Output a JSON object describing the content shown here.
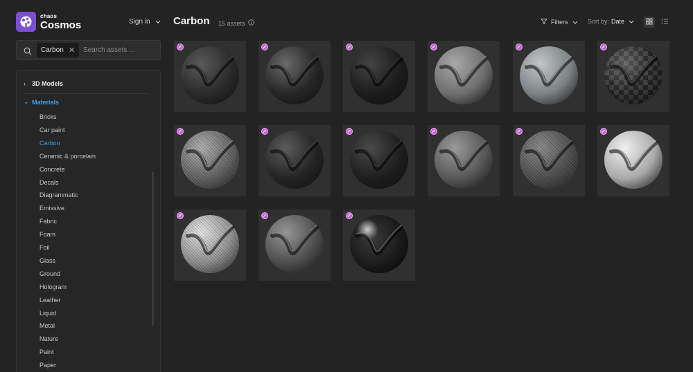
{
  "app": {
    "brand_top": "chaos",
    "brand_main": "Cosmos",
    "signin_label": "Sign in",
    "accent": "#3aa0e8",
    "brand_color": "#7a4fd0"
  },
  "search": {
    "chip_label": "Carbon",
    "placeholder": "Search assets ..."
  },
  "tree": {
    "models_label": "3D Models",
    "materials_label": "Materials",
    "items": [
      {
        "label": "Bricks"
      },
      {
        "label": "Car paint"
      },
      {
        "label": "Carbon",
        "active": true
      },
      {
        "label": "Ceramic & porcelain"
      },
      {
        "label": "Concrete"
      },
      {
        "label": "Decals"
      },
      {
        "label": "Diagrammatic"
      },
      {
        "label": "Emissive"
      },
      {
        "label": "Fabric"
      },
      {
        "label": "Foam"
      },
      {
        "label": "Foil"
      },
      {
        "label": "Glass"
      },
      {
        "label": "Ground"
      },
      {
        "label": "Hologram"
      },
      {
        "label": "Leather"
      },
      {
        "label": "Liquid"
      },
      {
        "label": "Metal"
      },
      {
        "label": "Nature"
      },
      {
        "label": "Paint"
      },
      {
        "label": "Paper"
      }
    ]
  },
  "header": {
    "title": "Carbon",
    "count": "15 assets",
    "filters_label": "Filters",
    "sort_prefix": "Sort by:",
    "sort_value": "Date"
  },
  "assets": [
    {
      "tone": "#2a2a2a",
      "hi": "#5a5a5a",
      "pattern": "none"
    },
    {
      "tone": "#262626",
      "hi": "#6a6a6a",
      "pattern": "none"
    },
    {
      "tone": "#1c1c1c",
      "hi": "#444444",
      "pattern": "none"
    },
    {
      "tone": "#6e6e6e",
      "hi": "#a8a8a8",
      "pattern": "none"
    },
    {
      "tone": "#7d8284",
      "hi": "#c2c6c8",
      "pattern": "none"
    },
    {
      "tone": "#2f2f2f",
      "hi": "#5e5e5e",
      "pattern": "checker"
    },
    {
      "tone": "#5f5f5f",
      "hi": "#b0b0b0",
      "pattern": "weave"
    },
    {
      "tone": "#242424",
      "hi": "#5c5c5c",
      "pattern": "none"
    },
    {
      "tone": "#1e1e1e",
      "hi": "#4a4a4a",
      "pattern": "none"
    },
    {
      "tone": "#585858",
      "hi": "#9a9a9a",
      "pattern": "none"
    },
    {
      "tone": "#4a4a4a",
      "hi": "#8a8a8a",
      "pattern": "weave"
    },
    {
      "tone": "#a9a9a9",
      "hi": "#f0f0f0",
      "pattern": "none"
    },
    {
      "tone": "#8e8e8e",
      "hi": "#e8e8e8",
      "pattern": "weave"
    },
    {
      "tone": "#4e4e4e",
      "hi": "#959595",
      "pattern": "none"
    },
    {
      "tone": "#1a1a1a",
      "hi": "#8a8a8a",
      "pattern": "gloss"
    }
  ]
}
